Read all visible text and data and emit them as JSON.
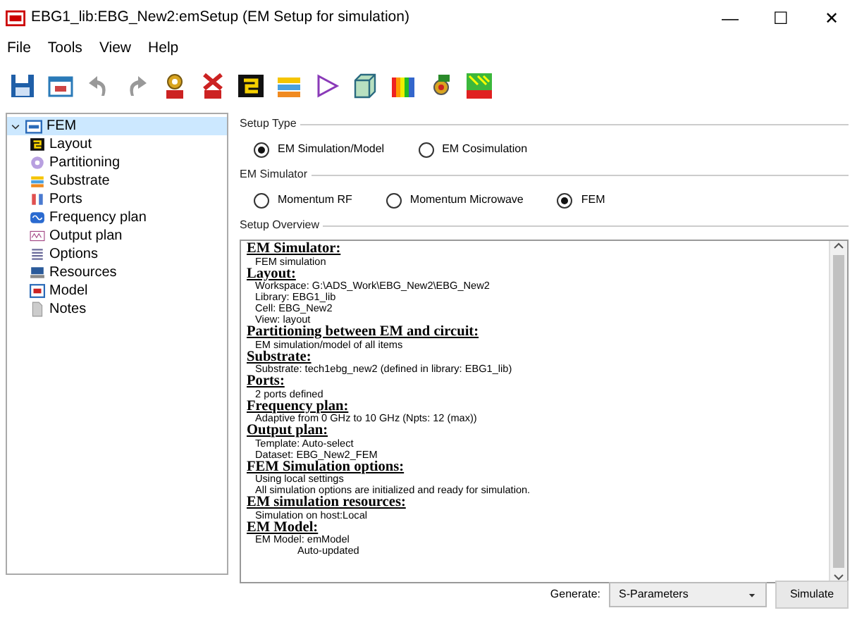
{
  "window": {
    "title": "EBG1_lib:EBG_New2:emSetup (EM Setup for simulation)",
    "controls": [
      "—",
      "☐",
      "✕"
    ]
  },
  "menu": [
    "File",
    "Tools",
    "View",
    "Help"
  ],
  "tree": {
    "label": "FEM",
    "expanded": true,
    "selected": true,
    "children": [
      {
        "label": "Layout",
        "selected": false
      },
      {
        "label": "Partitioning",
        "selected": false
      },
      {
        "label": "Substrate",
        "selected": false
      },
      {
        "label": "Ports",
        "selected": false
      },
      {
        "label": "Frequency plan",
        "selected": false
      },
      {
        "label": "Output plan",
        "selected": false
      },
      {
        "label": "Options",
        "selected": false
      },
      {
        "label": "Resources",
        "selected": false
      },
      {
        "label": "Model",
        "selected": false
      },
      {
        "label": "Notes",
        "selected": false
      }
    ]
  },
  "groups": [
    {
      "title": "Setup Type",
      "options": [
        {
          "label": "EM Simulation/Model",
          "selected": true
        },
        {
          "label": "EM Cosimulation",
          "selected": false
        }
      ]
    },
    {
      "title": "EM Simulator",
      "options": [
        {
          "label": "Momentum RF",
          "selected": false
        },
        {
          "label": "Momentum Microwave",
          "selected": false
        },
        {
          "label": "FEM",
          "selected": true
        }
      ]
    }
  ],
  "overview": {
    "title": "Setup Overview",
    "sections": [
      {
        "heading": "EM Simulator:",
        "lines": [
          {
            "text": "FEM simulation"
          }
        ]
      },
      {
        "heading": "Layout:",
        "lines": [
          {
            "text": "Workspace: G:\\ADS_Work\\EBG_New2\\EBG_New2"
          },
          {
            "text": "Library: EBG1_lib"
          },
          {
            "text": "Cell: EBG_New2"
          },
          {
            "text": "View: layout"
          }
        ]
      },
      {
        "heading": "Partitioning between EM and circuit:",
        "lines": [
          {
            "text": "EM simulation/model of all items"
          }
        ]
      },
      {
        "heading": "Substrate:",
        "lines": [
          {
            "text": "Substrate: tech1ebg_new2 (defined in library: EBG1_lib)"
          }
        ]
      },
      {
        "heading": "Ports:",
        "lines": [
          {
            "text": "2 ports defined"
          }
        ]
      },
      {
        "heading": "Frequency plan:",
        "lines": [
          {
            "text": "Adaptive from 0 GHz to 10 GHz (Npts: 12 (max))"
          }
        ]
      },
      {
        "heading": "Output plan:",
        "lines": [
          {
            "text": "Template: Auto-select"
          },
          {
            "text": "Dataset: EBG_New2_FEM"
          }
        ]
      },
      {
        "heading": "FEM Simulation options:",
        "lines": [
          {
            "text": "Using local settings"
          },
          {
            "text": "All simulation options are initialized and ready for simulation."
          }
        ]
      },
      {
        "heading": "EM simulation resources:",
        "lines": [
          {
            "text": "Simulation on host:Local"
          }
        ]
      },
      {
        "heading": "EM Model:",
        "lines": [
          {
            "text": "EM Model: emModel",
            "children": [
              {
                "text": "Auto-updated"
              }
            ]
          }
        ]
      }
    ]
  },
  "footer": {
    "generate_label": "Generate:",
    "generate_value": "S-Parameters",
    "button": "Simulate"
  }
}
